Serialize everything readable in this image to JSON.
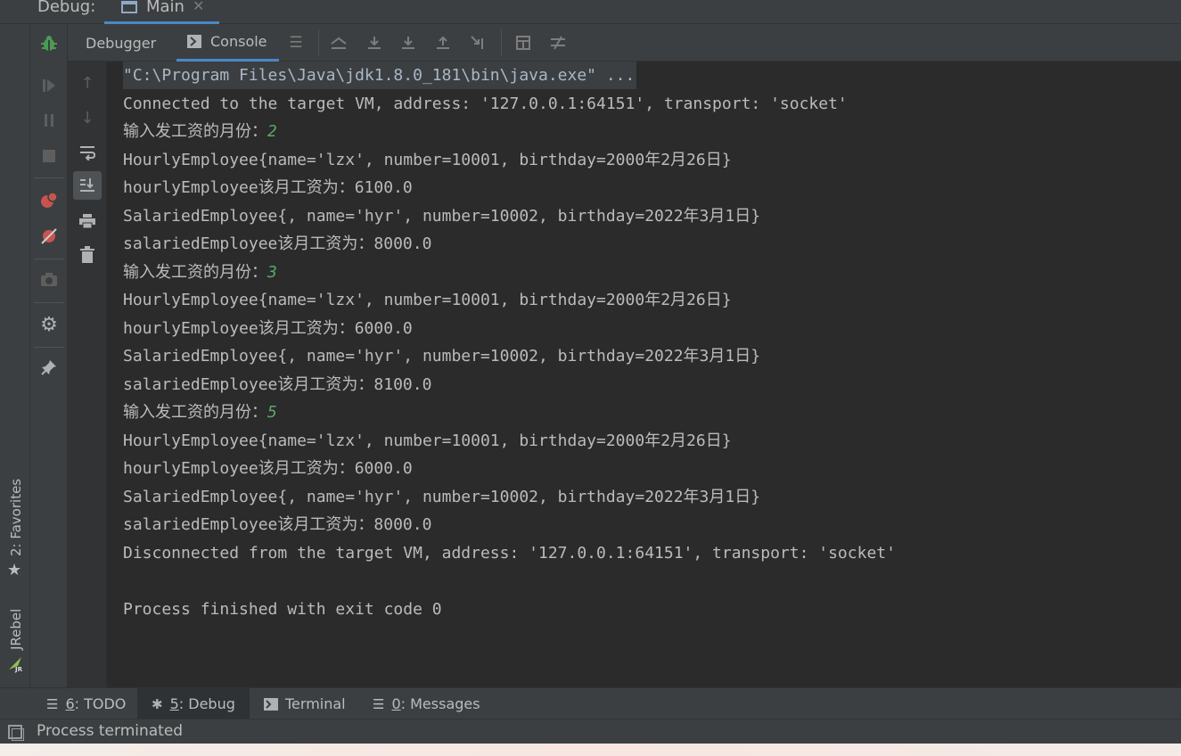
{
  "window": {
    "debug_label": "Debug:",
    "run_tab": "Main"
  },
  "toolbar": {
    "debugger_tab": "Debugger",
    "console_tab": "Console"
  },
  "left_strip": {
    "favorites": "2: Favorites",
    "jrebel": "JRebel",
    "jrebel_badge": "JR"
  },
  "console": {
    "lines": [
      {
        "text": "\"C:\\Program Files\\Java\\jdk1.8.0_181\\bin\\java.exe\" ..."
      },
      {
        "text": "Connected to the target VM, address: '127.0.0.1:64151', transport: 'socket'"
      },
      {
        "text": "输入发工资的月份：",
        "input": "2"
      },
      {
        "text": "HourlyEmployee{name='lzx', number=10001, birthday=2000年2月26日}"
      },
      {
        "text": "hourlyEmployee该月工资为：6100.0"
      },
      {
        "text": "SalariedEmployee{, name='hyr', number=10002, birthday=2022年3月1日}"
      },
      {
        "text": "salariedEmployee该月工资为：8000.0"
      },
      {
        "text": "输入发工资的月份：",
        "input": "3"
      },
      {
        "text": "HourlyEmployee{name='lzx', number=10001, birthday=2000年2月26日}"
      },
      {
        "text": "hourlyEmployee该月工资为：6000.0"
      },
      {
        "text": "SalariedEmployee{, name='hyr', number=10002, birthday=2022年3月1日}"
      },
      {
        "text": "salariedEmployee该月工资为：8100.0"
      },
      {
        "text": "输入发工资的月份：",
        "input": "5"
      },
      {
        "text": "HourlyEmployee{name='lzx', number=10001, birthday=2000年2月26日}"
      },
      {
        "text": "hourlyEmployee该月工资为：6000.0"
      },
      {
        "text": "SalariedEmployee{, name='hyr', number=10002, birthday=2022年3月1日}"
      },
      {
        "text": "salariedEmployee该月工资为：8000.0"
      },
      {
        "text": "Disconnected from the target VM, address: '127.0.0.1:64151', transport: 'socket'"
      },
      {
        "text": ""
      },
      {
        "text": "Process finished with exit code 0"
      }
    ]
  },
  "bottom_tabs": {
    "todo_num": "6",
    "todo": ": TODO",
    "debug_num": "5",
    "debug": ": Debug",
    "terminal": "Terminal",
    "messages_num": "0",
    "messages": ": Messages"
  },
  "status": {
    "text": "Process terminated"
  },
  "colors": {
    "accent": "#4a88c7",
    "user_input": "#59a869",
    "debug_green": "#499c54",
    "breakpoint_red": "#c75450"
  }
}
